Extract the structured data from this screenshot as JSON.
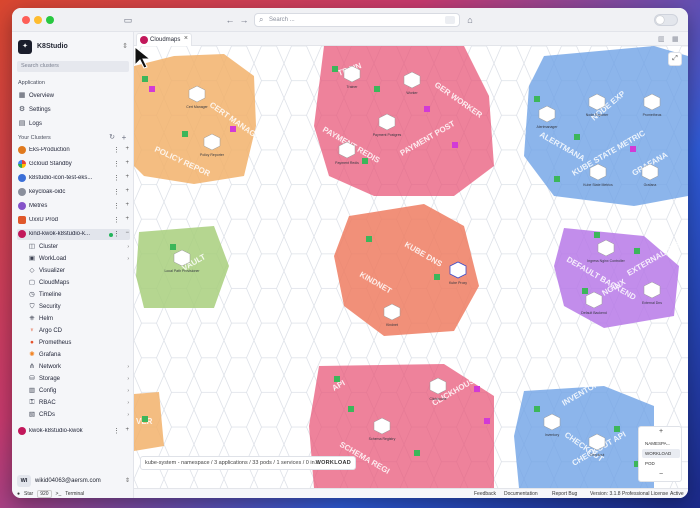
{
  "app": {
    "name": "K8Studio",
    "search_placeholder": "Search ..."
  },
  "sidebar": {
    "cluster_search_placeholder": "Search clusters",
    "section_application": "Application",
    "app_items": [
      {
        "label": "Overview",
        "icon": "grid-icon"
      },
      {
        "label": "Settings",
        "icon": "gear-icon"
      },
      {
        "label": "Logs",
        "icon": "document-icon"
      }
    ],
    "section_clusters": "Your Clusters",
    "clusters": [
      {
        "label": "Eks-Production",
        "color": "#e07a1f"
      },
      {
        "label": "Gcloud Standby",
        "color": "#e9a23b"
      },
      {
        "label": "k8studio-icon-test-eks...",
        "color": "#3b6fd8"
      },
      {
        "label": "keycloak-oidc",
        "color": "#8a8f9c"
      },
      {
        "label": "Metres",
        "color": "#8553c9"
      },
      {
        "label": "UxxU Prod",
        "color": "#e0582b"
      },
      {
        "label": "kind-kwok-k8studio-k...",
        "color": "#c2185b"
      }
    ],
    "cluster_sub": [
      {
        "label": "Cluster",
        "icon": "cluster-icon",
        "chevron": true
      },
      {
        "label": "WorkLoad",
        "icon": "workload-icon",
        "chevron": true
      },
      {
        "label": "Visualizer",
        "icon": "visualizer-icon",
        "chevron": false
      },
      {
        "label": "CloudMaps",
        "icon": "cloudmaps-icon",
        "chevron": false
      },
      {
        "label": "Timeline",
        "icon": "timeline-icon",
        "chevron": false
      },
      {
        "label": "Security",
        "icon": "shield-icon",
        "chevron": false
      },
      {
        "label": "Helm",
        "icon": "helm-icon",
        "chevron": false
      },
      {
        "label": "Argo CD",
        "icon": "argo-icon",
        "chevron": false
      },
      {
        "label": "Prometheus",
        "icon": "prometheus-icon",
        "chevron": false
      },
      {
        "label": "Grafana",
        "icon": "grafana-icon",
        "chevron": false
      },
      {
        "label": "Network",
        "icon": "network-icon",
        "chevron": true
      },
      {
        "label": "Storage",
        "icon": "storage-icon",
        "chevron": true
      },
      {
        "label": "Config",
        "icon": "config-icon",
        "chevron": true
      },
      {
        "label": "RBAC",
        "icon": "rbac-icon",
        "chevron": true
      },
      {
        "label": "CRDs",
        "icon": "crd-icon",
        "chevron": true
      }
    ],
    "extra_cluster": {
      "label": "kwok-k8studio-kwok",
      "color": "#c2185b"
    },
    "user": {
      "initials": "WI",
      "email": "wikid04063@aersm.com"
    },
    "footer": {
      "star": "Star",
      "star_count": "920",
      "terminal": "Terminal"
    }
  },
  "main": {
    "tab_label": "Cloudmaps",
    "info_text": "kube-system - namespace / 3 applications / 33 pods / 1 services / 0 in...",
    "workload_label": "WORKLOAD",
    "zoom": {
      "plus": "+",
      "minus": "−",
      "options": [
        "NAMESPA...",
        "WORKLOAD",
        "POD"
      ],
      "selected": "WORKLOAD"
    },
    "map_labels": {
      "cert_manager": "CERT MANAGE",
      "policy_reporter": "POLICY REPOR",
      "trainer": "TRAIN",
      "payment_redis": "PAYMENT REDIS",
      "payment_postgres": "PAYMENT POST",
      "worker": "GER WORKER",
      "kube_state": "KUBE STATE METRIC",
      "grafana": "GRAFANA",
      "node_exporter": "NODE EXP",
      "alertmanager": "ALERTMANA",
      "kube_dns": "KUBE DNS",
      "kindnet": "KINDNET",
      "default_backend": "DEFAULT BACKEND",
      "nginx": "NGINX",
      "external_dns": "EXTERNALDNS",
      "vault": "VAULT",
      "clickhouse": "CLICKHOUSE",
      "checkout": "CHECKOUT",
      "checkout_api": "CHECKOUT API",
      "schema_registry": "SCHEMA REGI",
      "inventory": "INVENTORY",
      "api": "API",
      "ver": "VER"
    },
    "node_labels": {
      "policy_reporter": "Policy Reporter",
      "kube_proxy": "Kube Proxy",
      "kindnet": "Kindnet",
      "external_dns": "External Dns",
      "default_backend": "Default Backend",
      "ingress_nginx": "Ingress Nginx Controller",
      "grafana": "Grafana",
      "node_exporter": "Node Exporter",
      "kube_state_metrics": "Kube State Metrics",
      "alertmanager": "Alertmanager",
      "prometheus": "Prometheus",
      "cert_manager": "Cert Manager",
      "trainer": "Trainer",
      "payment_redis": "Payment Redis",
      "payment_postgres": "Payment Postgres",
      "worker": "Worker",
      "local_path": "Local Path Provisioner",
      "clickhouse": "Clickhouse",
      "schema_registry": "Schema Registry",
      "checkout": "Checkout",
      "inventory": "Inventory"
    }
  },
  "statusbar": {
    "feedback": "Feedback",
    "documentation": "Documentation",
    "report_bug": "Report Bug",
    "version": "Version: 3.1.8",
    "license": "Professional License",
    "active": "Active"
  },
  "colors": {
    "orange_region": "#f2b26b",
    "pink_region": "#e8587a",
    "blue_region": "#6fa3e6",
    "coral_region": "#ef7c62",
    "purple_region": "#b779e8",
    "green_region": "#a8cf7d",
    "green_block": "#3cb65a",
    "magenta_block": "#d23ad6"
  }
}
